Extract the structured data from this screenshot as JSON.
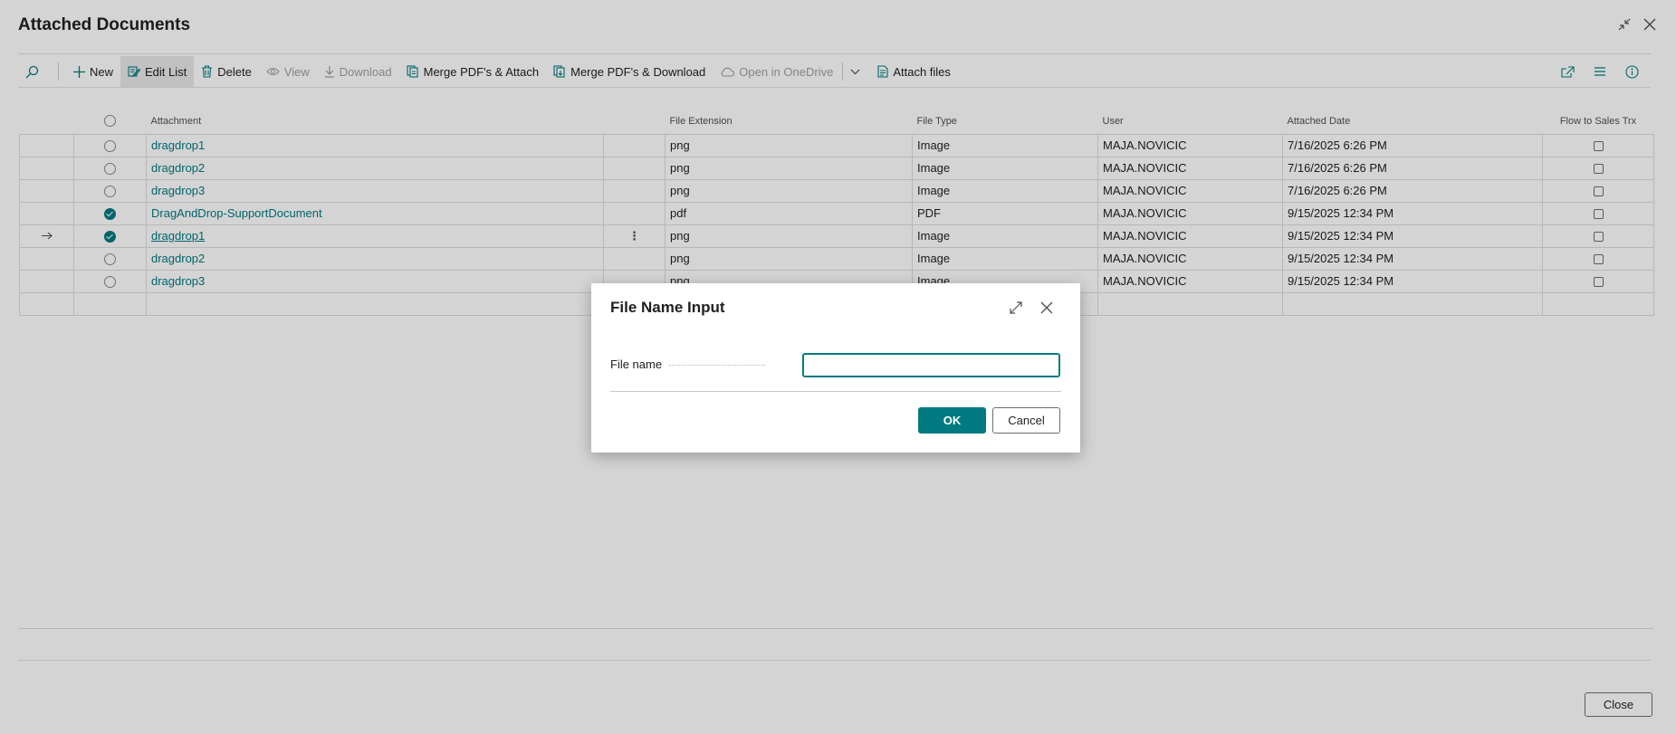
{
  "page": {
    "title": "Attached Documents"
  },
  "toolbar": {
    "new_label": "New",
    "edit_list_label": "Edit List",
    "delete_label": "Delete",
    "view_label": "View",
    "download_label": "Download",
    "merge_attach_label": "Merge PDF's & Attach",
    "merge_download_label": "Merge PDF's & Download",
    "open_onedrive_label": "Open in OneDrive",
    "attach_files_label": "Attach files"
  },
  "table": {
    "columns": {
      "attachment": "Attachment",
      "file_extension": "File Extension",
      "file_type": "File Type",
      "user": "User",
      "attached_date": "Attached Date",
      "flow_to_sales": "Flow to Sales Trx"
    },
    "rows": [
      {
        "attachment": "dragdrop1",
        "ext": "png",
        "type": "Image",
        "user": "MAJA.NOVICIC",
        "date": "7/16/2025 6:26 PM",
        "selected": false,
        "current": false
      },
      {
        "attachment": "dragdrop2",
        "ext": "png",
        "type": "Image",
        "user": "MAJA.NOVICIC",
        "date": "7/16/2025 6:26 PM",
        "selected": false,
        "current": false
      },
      {
        "attachment": "dragdrop3",
        "ext": "png",
        "type": "Image",
        "user": "MAJA.NOVICIC",
        "date": "7/16/2025 6:26 PM",
        "selected": false,
        "current": false
      },
      {
        "attachment": "DragAndDrop-SupportDocument",
        "ext": "pdf",
        "type": "PDF",
        "user": "MAJA.NOVICIC",
        "date": "9/15/2025 12:34 PM",
        "selected": true,
        "current": false
      },
      {
        "attachment": "dragdrop1",
        "ext": "png",
        "type": "Image",
        "user": "MAJA.NOVICIC",
        "date": "9/15/2025 12:34 PM",
        "selected": true,
        "current": true
      },
      {
        "attachment": "dragdrop2",
        "ext": "png",
        "type": "Image",
        "user": "MAJA.NOVICIC",
        "date": "9/15/2025 12:34 PM",
        "selected": false,
        "current": false
      },
      {
        "attachment": "dragdrop3",
        "ext": "png",
        "type": "Image",
        "user": "MAJA.NOVICIC",
        "date": "9/15/2025 12:34 PM",
        "selected": false,
        "current": false
      }
    ]
  },
  "footer": {
    "close_label": "Close"
  },
  "dialog": {
    "title": "File Name Input",
    "field_label": "File name",
    "field_value": "",
    "ok_label": "OK",
    "cancel_label": "Cancel"
  },
  "colors": {
    "accent": "#007a80",
    "overlay": "rgba(0,0,0,0.17)"
  }
}
